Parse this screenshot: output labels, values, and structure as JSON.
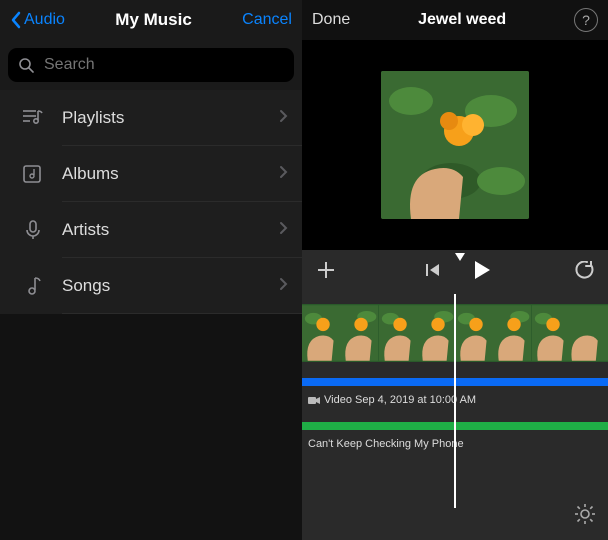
{
  "left": {
    "back_label": "Audio",
    "title": "My Music",
    "cancel_label": "Cancel",
    "search_placeholder": "Search",
    "rows": [
      {
        "label": "Playlists",
        "icon": "playlists-icon"
      },
      {
        "label": "Albums",
        "icon": "albums-icon"
      },
      {
        "label": "Artists",
        "icon": "artists-icon"
      },
      {
        "label": "Songs",
        "icon": "songs-icon"
      }
    ]
  },
  "right": {
    "done_label": "Done",
    "title": "Jewel weed",
    "help_glyph": "?",
    "video_clip_label": "Video Sep 4, 2019 at 10:00 AM",
    "audio_clip_label": "Can't Keep Checking My Phone"
  },
  "colors": {
    "accent": "#0a84ff",
    "video_track": "#0a6af5",
    "audio_track": "#1fae46"
  }
}
